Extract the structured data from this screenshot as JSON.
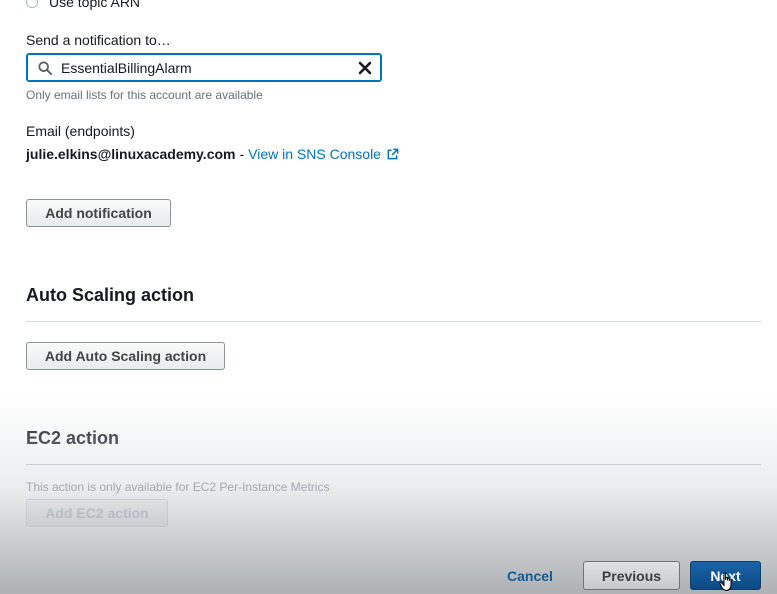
{
  "topic": {
    "radio_label": "Use topic ARN"
  },
  "notification": {
    "send_to_label": "Send a notification to…",
    "search_value": "EssentialBillingAlarm",
    "hint": "Only email lists for this account are available",
    "endpoints_label": "Email (endpoints)",
    "email": "julie.elkins@linuxacademy.com",
    "separator": "-",
    "sns_link": "View in SNS Console",
    "add_button": "Add notification"
  },
  "autoscaling": {
    "title": "Auto Scaling action",
    "add_button": "Add Auto Scaling action"
  },
  "ec2": {
    "title": "EC2 action",
    "note": "This action is only available for EC2 Per-Instance Metrics",
    "add_button": "Add EC2 action"
  },
  "footer": {
    "cancel": "Cancel",
    "previous": "Previous",
    "next": "Next"
  },
  "icons": {
    "search": "search-icon",
    "clear": "clear-icon",
    "external": "external-link-icon",
    "cursor": "hand-cursor-icon"
  },
  "colors": {
    "link": "#0073bb",
    "primary": "#0c4a86",
    "focus_border": "#0073bb"
  }
}
